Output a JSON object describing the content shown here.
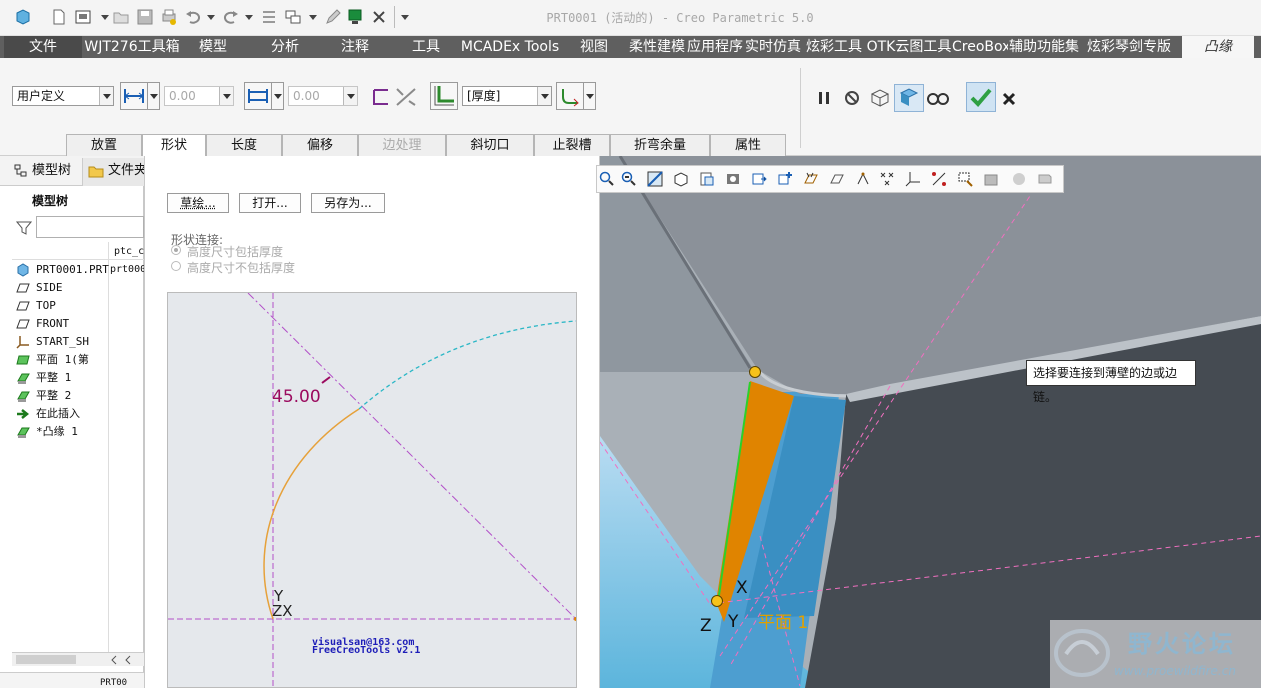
{
  "window": {
    "title": "PRT0001 (活动的) - Creo Parametric 5.0"
  },
  "menu": {
    "tabs": [
      "文件",
      "WJT276工具箱",
      "模型",
      "分析",
      "注释",
      "工具",
      "MCADEx Tools",
      "视图",
      "柔性建模",
      "应用程序",
      "实时仿真",
      "炫彩工具",
      "OTK云图工具",
      "CreoBox",
      "辅助功能集",
      "炫彩琴剑专版",
      "凸缘"
    ]
  },
  "ribbon": {
    "shape_select": "用户定义",
    "length_value": "0.00",
    "offset_value": "0.00",
    "thickness_select": "[厚度]"
  },
  "panel_tabs": [
    "放置",
    "形状",
    "长度",
    "偏移",
    "边处理",
    "斜切口",
    "止裂槽",
    "折弯余量",
    "属性"
  ],
  "left_panel": {
    "tab_model_tree": "模型树",
    "tab_folder": "文件夹",
    "header": "模型树",
    "column_header": "ptc_c",
    "root_extra": "prt000",
    "items": [
      "PRT0001.PRT",
      "SIDE",
      "TOP",
      "FRONT",
      "START_SHI",
      "平面 1(第",
      "平整 1",
      "平整 2",
      "在此插入",
      "*凸缘 1"
    ],
    "bottom_label": "PRT00"
  },
  "shape_panel": {
    "btn_sketch": "草绘...",
    "btn_open": "打开...",
    "btn_save_as": "另存为...",
    "connection_label": "形状连接:",
    "radio_include": "高度尺寸包括厚度",
    "radio_exclude": "高度尺寸不包括厚度",
    "dim_angle": "45.00",
    "axis_y": "Y",
    "axis_zx": "ZX",
    "credit_line1": "visualsan@163.com",
    "credit_line2": "FreeCreoTools v2.1"
  },
  "viewport": {
    "tooltip": "选择要连接到薄壁的边或边链。",
    "axis_x": "X",
    "axis_y": "Y",
    "axis_z": "Z",
    "plane_label": "平面 1"
  },
  "watermark": {
    "name": "野火论坛",
    "url": "www.proewildfire.cn"
  },
  "colors": {
    "accent_orange": "#e08400",
    "selected_blue": "#3a8fc2",
    "confirm_green": "#2ea043",
    "dim_magenta": "#9b0b5f"
  }
}
